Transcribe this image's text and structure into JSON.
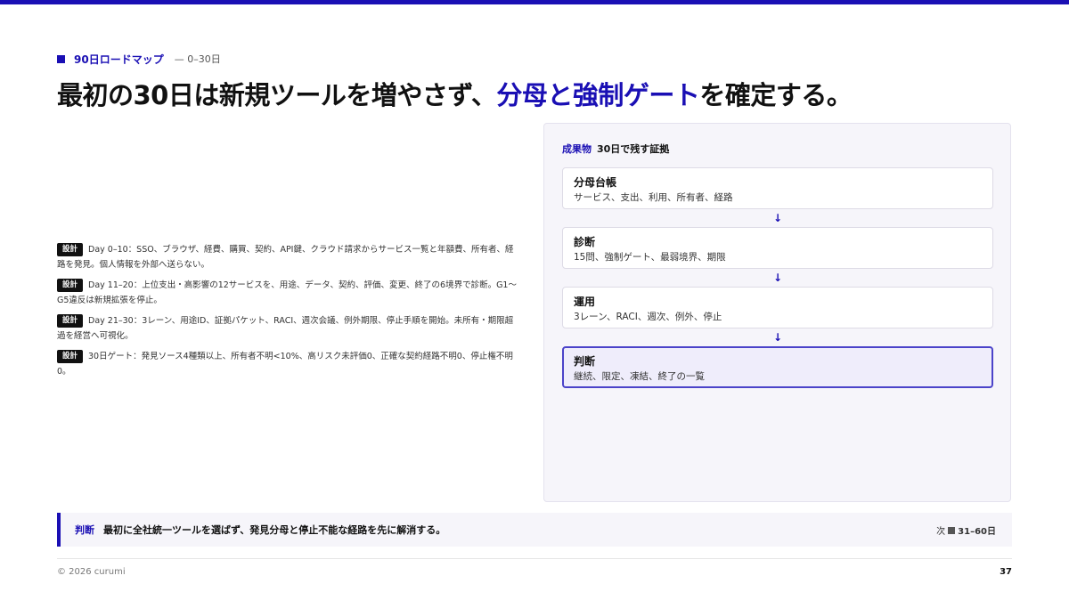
{
  "eyebrow": {
    "label": "90日ロードマップ",
    "range": "— 0–30日"
  },
  "headline": {
    "before": "最初の30日は新規ツールを増やさず、",
    "highlight": "分母と強制ゲート",
    "after": "を確定する。"
  },
  "items": [
    {
      "tag": "設計",
      "text": "Day 0–10：SSO、ブラウザ、経費、購買、契約、API鍵、クラウド請求からサービス一覧と年額費、所有者、経路を発見。個人情報を外部へ送らない。"
    },
    {
      "tag": "設計",
      "text": "Day 11–20：上位支出・高影響の12サービスを、用途、データ、契約、評価、変更、終了の6境界で診断。G1〜G5違反は新規拡張を停止。"
    },
    {
      "tag": "設計",
      "text": "Day 21–30：3レーン、用途ID、証拠パケット、RACI、週次会議、例外期限、停止手順を開始。未所有・期限超過を経営へ可視化。"
    },
    {
      "tag": "設計",
      "text": "30日ゲート：発見ソース4種類以上、所有者不明<10%、高リスク未評価0、正確な契約経路不明0、停止権不明0。"
    }
  ],
  "panel": {
    "title_accent": "成果物",
    "title": "30日で残す証拠",
    "arrow": "↓",
    "steps": [
      {
        "title": "分母台帳",
        "desc": "サービス、支出、利用、所有者、経路"
      },
      {
        "title": "診断",
        "desc": "15問、強制ゲート、最弱境界、期限"
      },
      {
        "title": "運用",
        "desc": "3レーン、RACI、週次、例外、停止"
      },
      {
        "title": "判断",
        "desc": "継続、限定、凍結、終了の一覧"
      }
    ]
  },
  "verdict": {
    "label": "判断",
    "text": "最初に全社統一ツールを選ばず、発見分母と停止不能な経路を先に解消する。",
    "next_label": "次",
    "next_range": "31–60日"
  },
  "footer": {
    "copyright": "© 2026 curumi",
    "page": "37"
  },
  "colors": {
    "accent": "#1a0fb4",
    "panel_bg": "#f6f5fa",
    "final_card_border": "#4b43c9"
  }
}
